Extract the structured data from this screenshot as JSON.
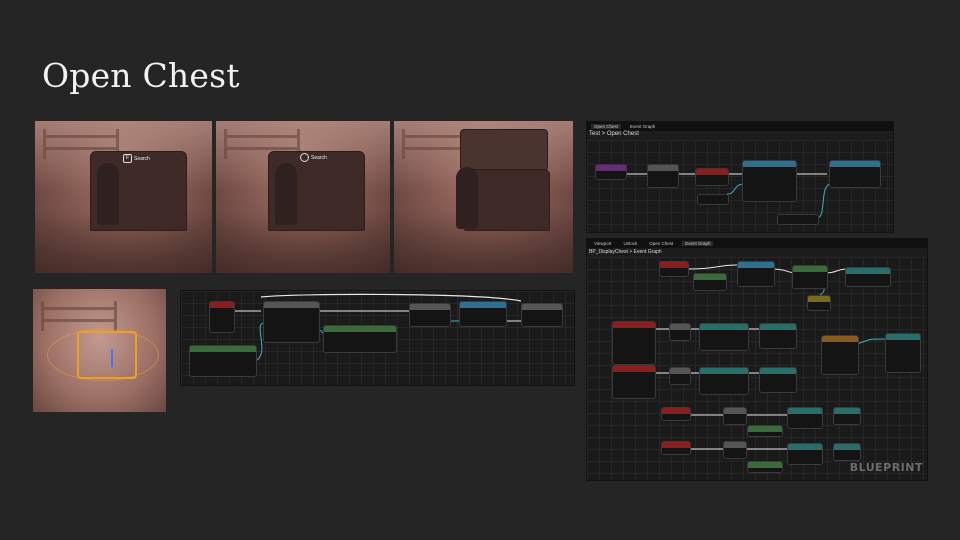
{
  "slide": {
    "title": "Open Chest"
  },
  "game_shots": {
    "prompt_label": "Search"
  },
  "blueprint_top": {
    "tabs": [
      "Open Chest",
      "Event Graph"
    ],
    "breadcrumb": "Test > Open Chest"
  },
  "blueprint_right": {
    "tabs": [
      "Viewport",
      "Unlock",
      "Open Chest",
      "Event Graph"
    ],
    "breadcrumb": "BP_DisplayChest > Event Graph",
    "watermark": "BLUEPRINT"
  },
  "colors": {
    "background": "#252525",
    "title": "#f2f2f2",
    "scene": "#8a5f56",
    "exec_pin": "#ffffff",
    "object_pin": "#55aabb"
  },
  "icons": [
    "keyboard-key-icon",
    "interaction-ring-icon",
    "transform-gizmo-icon"
  ]
}
